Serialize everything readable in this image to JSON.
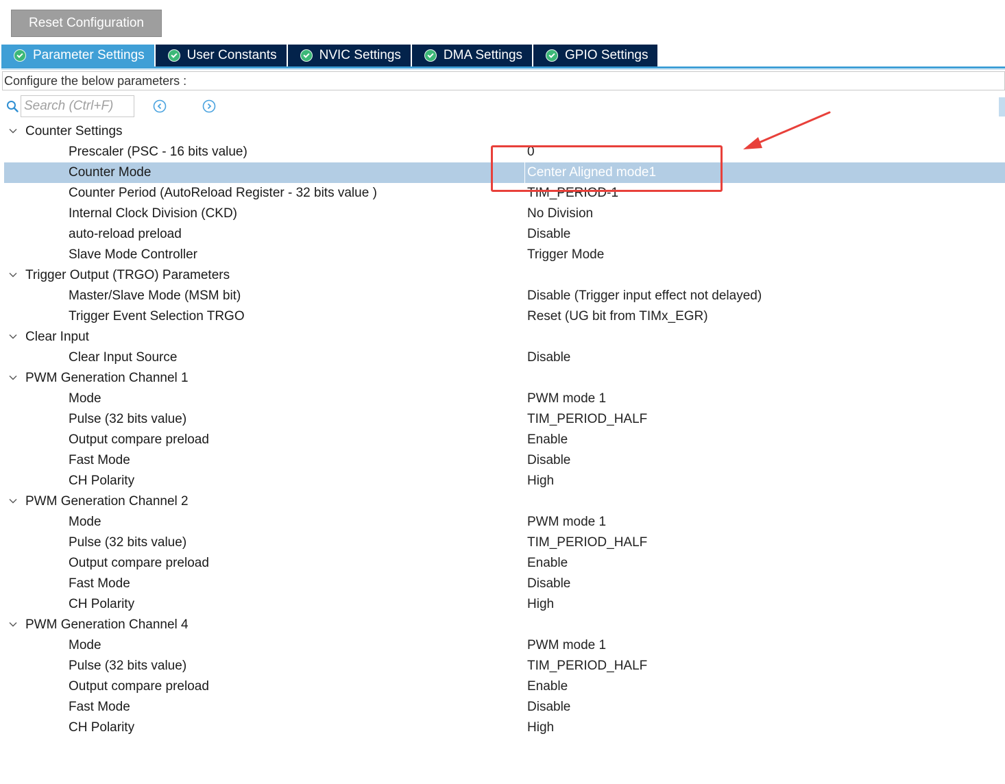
{
  "toolbar": {
    "reset_label": "Reset Configuration"
  },
  "tabs": [
    {
      "label": "Parameter Settings",
      "active": true
    },
    {
      "label": "User Constants",
      "active": false
    },
    {
      "label": "NVIC Settings",
      "active": false
    },
    {
      "label": "DMA Settings",
      "active": false
    },
    {
      "label": "GPIO Settings",
      "active": false
    }
  ],
  "header": {
    "configure_text": "Configure the below parameters :"
  },
  "search": {
    "placeholder": "Search (Ctrl+F)"
  },
  "groups": [
    {
      "label": "Counter Settings",
      "params": [
        {
          "label": "Prescaler (PSC - 16 bits value)",
          "value": "0"
        },
        {
          "label": "Counter Mode",
          "value": "Center Aligned mode1",
          "selected": true
        },
        {
          "label": "Counter Period (AutoReload Register - 32 bits value )",
          "value": "TIM_PERIOD-1"
        },
        {
          "label": "Internal Clock Division (CKD)",
          "value": "No Division"
        },
        {
          "label": "auto-reload preload",
          "value": "Disable"
        },
        {
          "label": "Slave Mode Controller",
          "value": "Trigger Mode"
        }
      ]
    },
    {
      "label": "Trigger Output (TRGO) Parameters",
      "params": [
        {
          "label": "Master/Slave Mode (MSM bit)",
          "value": "Disable (Trigger input effect not delayed)"
        },
        {
          "label": "Trigger Event Selection TRGO",
          "value": "Reset (UG bit from TIMx_EGR)"
        }
      ]
    },
    {
      "label": "Clear Input",
      "params": [
        {
          "label": "Clear Input Source",
          "value": "Disable"
        }
      ]
    },
    {
      "label": "PWM Generation Channel 1",
      "params": [
        {
          "label": "Mode",
          "value": "PWM mode 1"
        },
        {
          "label": "Pulse (32 bits value)",
          "value": "TIM_PERIOD_HALF"
        },
        {
          "label": "Output compare preload",
          "value": "Enable"
        },
        {
          "label": "Fast Mode",
          "value": "Disable"
        },
        {
          "label": "CH Polarity",
          "value": "High"
        }
      ]
    },
    {
      "label": "PWM Generation Channel 2",
      "params": [
        {
          "label": "Mode",
          "value": "PWM mode 1"
        },
        {
          "label": "Pulse (32 bits value)",
          "value": "TIM_PERIOD_HALF"
        },
        {
          "label": "Output compare preload",
          "value": "Enable"
        },
        {
          "label": "Fast Mode",
          "value": "Disable"
        },
        {
          "label": "CH Polarity",
          "value": "High"
        }
      ]
    },
    {
      "label": "PWM Generation Channel 4",
      "params": [
        {
          "label": "Mode",
          "value": "PWM mode 1"
        },
        {
          "label": "Pulse (32 bits value)",
          "value": "TIM_PERIOD_HALF"
        },
        {
          "label": "Output compare preload",
          "value": "Enable"
        },
        {
          "label": "Fast Mode",
          "value": "Disable"
        },
        {
          "label": "CH Polarity",
          "value": "High"
        }
      ]
    }
  ],
  "colors": {
    "tab_active": "#3f9fd6",
    "tab_inactive": "#03234b",
    "selected_row": "#b3cde4",
    "annotation": "#e8403a"
  },
  "icons": [
    "check-icon",
    "search-icon",
    "prev-icon",
    "next-icon",
    "chevron-down-icon"
  ]
}
